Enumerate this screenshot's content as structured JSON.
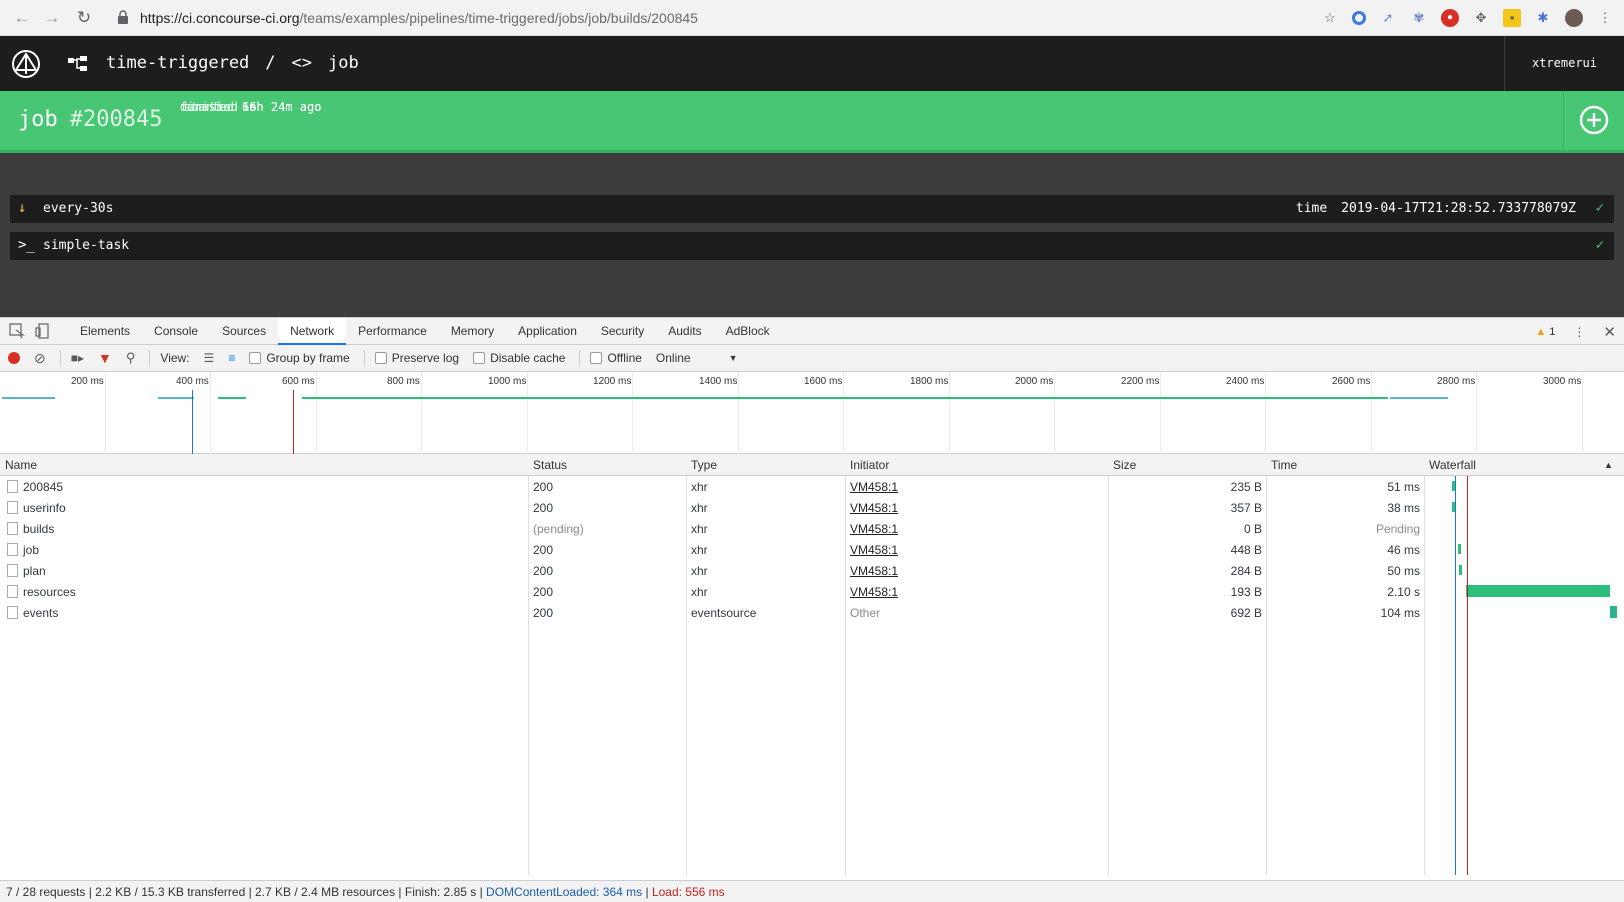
{
  "browser": {
    "url_host": "https://ci.concourse-ci.org",
    "url_path": "/teams/examples/pipelines/time-triggered/jobs/job/builds/200845"
  },
  "topbar": {
    "pipeline": "time-triggered",
    "separator": "/",
    "job": "job",
    "user": "xtremerui"
  },
  "build": {
    "job_name": "job",
    "number": "#200845",
    "meta": [
      {
        "key": "started",
        "value": "16h 24m ago"
      },
      {
        "key": "finished",
        "value": "16h 24m ago"
      },
      {
        "key": "duration",
        "value": "6s"
      }
    ]
  },
  "steps": [
    {
      "name": "every-30s",
      "version_key": "time",
      "version_value": "2019-04-17T21:28:52.733778079Z",
      "status": "success"
    },
    {
      "name": "simple-task",
      "status": "success"
    }
  ],
  "devtools": {
    "tabs": [
      "Elements",
      "Console",
      "Sources",
      "Network",
      "Performance",
      "Memory",
      "Application",
      "Security",
      "Audits",
      "AdBlock"
    ],
    "active_tab": "Network",
    "warnings": "1",
    "toolbar": {
      "view_label": "View:",
      "group_by_frame": "Group by frame",
      "preserve_log": "Preserve log",
      "disable_cache": "Disable cache",
      "offline": "Offline",
      "throttle": "Online"
    },
    "overview_ticks": [
      "200 ms",
      "400 ms",
      "600 ms",
      "800 ms",
      "1000 ms",
      "1200 ms",
      "1400 ms",
      "1600 ms",
      "1800 ms",
      "2000 ms",
      "2200 ms",
      "2400 ms",
      "2600 ms",
      "2800 ms",
      "3000 ms"
    ],
    "columns": [
      "Name",
      "Status",
      "Type",
      "Initiator",
      "Size",
      "Time",
      "Waterfall"
    ],
    "requests": [
      {
        "name": "200845",
        "status": "200",
        "type": "xhr",
        "initiator": "VM458:1",
        "size": "235 B",
        "time": "51 ms"
      },
      {
        "name": "userinfo",
        "status": "200",
        "type": "xhr",
        "initiator": "VM458:1",
        "size": "357 B",
        "time": "38 ms"
      },
      {
        "name": "builds",
        "status": "(pending)",
        "type": "xhr",
        "initiator": "VM458:1",
        "size": "0 B",
        "time": "Pending"
      },
      {
        "name": "job",
        "status": "200",
        "type": "xhr",
        "initiator": "VM458:1",
        "size": "448 B",
        "time": "46 ms"
      },
      {
        "name": "plan",
        "status": "200",
        "type": "xhr",
        "initiator": "VM458:1",
        "size": "284 B",
        "time": "50 ms"
      },
      {
        "name": "resources",
        "status": "200",
        "type": "xhr",
        "initiator": "VM458:1",
        "size": "193 B",
        "time": "2.10 s"
      },
      {
        "name": "events",
        "status": "200",
        "type": "eventsource",
        "initiator": "Other",
        "size": "692 B",
        "time": "104 ms"
      }
    ],
    "status_summary": "7 / 28 requests | 2.2 KB / 15.3 KB transferred | 2.7 KB / 2.4 MB resources | Finish: 2.85 s | ",
    "dom_content_loaded": "DOMContentLoaded: 364 ms",
    "status_sep": " | ",
    "load": "Load: 556 ms"
  },
  "colors": {
    "concourse_dark": "#1e1d1d",
    "build_success": "#47c773",
    "steps_bg": "#3d3c3c",
    "waterfall_bar": "#2cbf7c"
  }
}
